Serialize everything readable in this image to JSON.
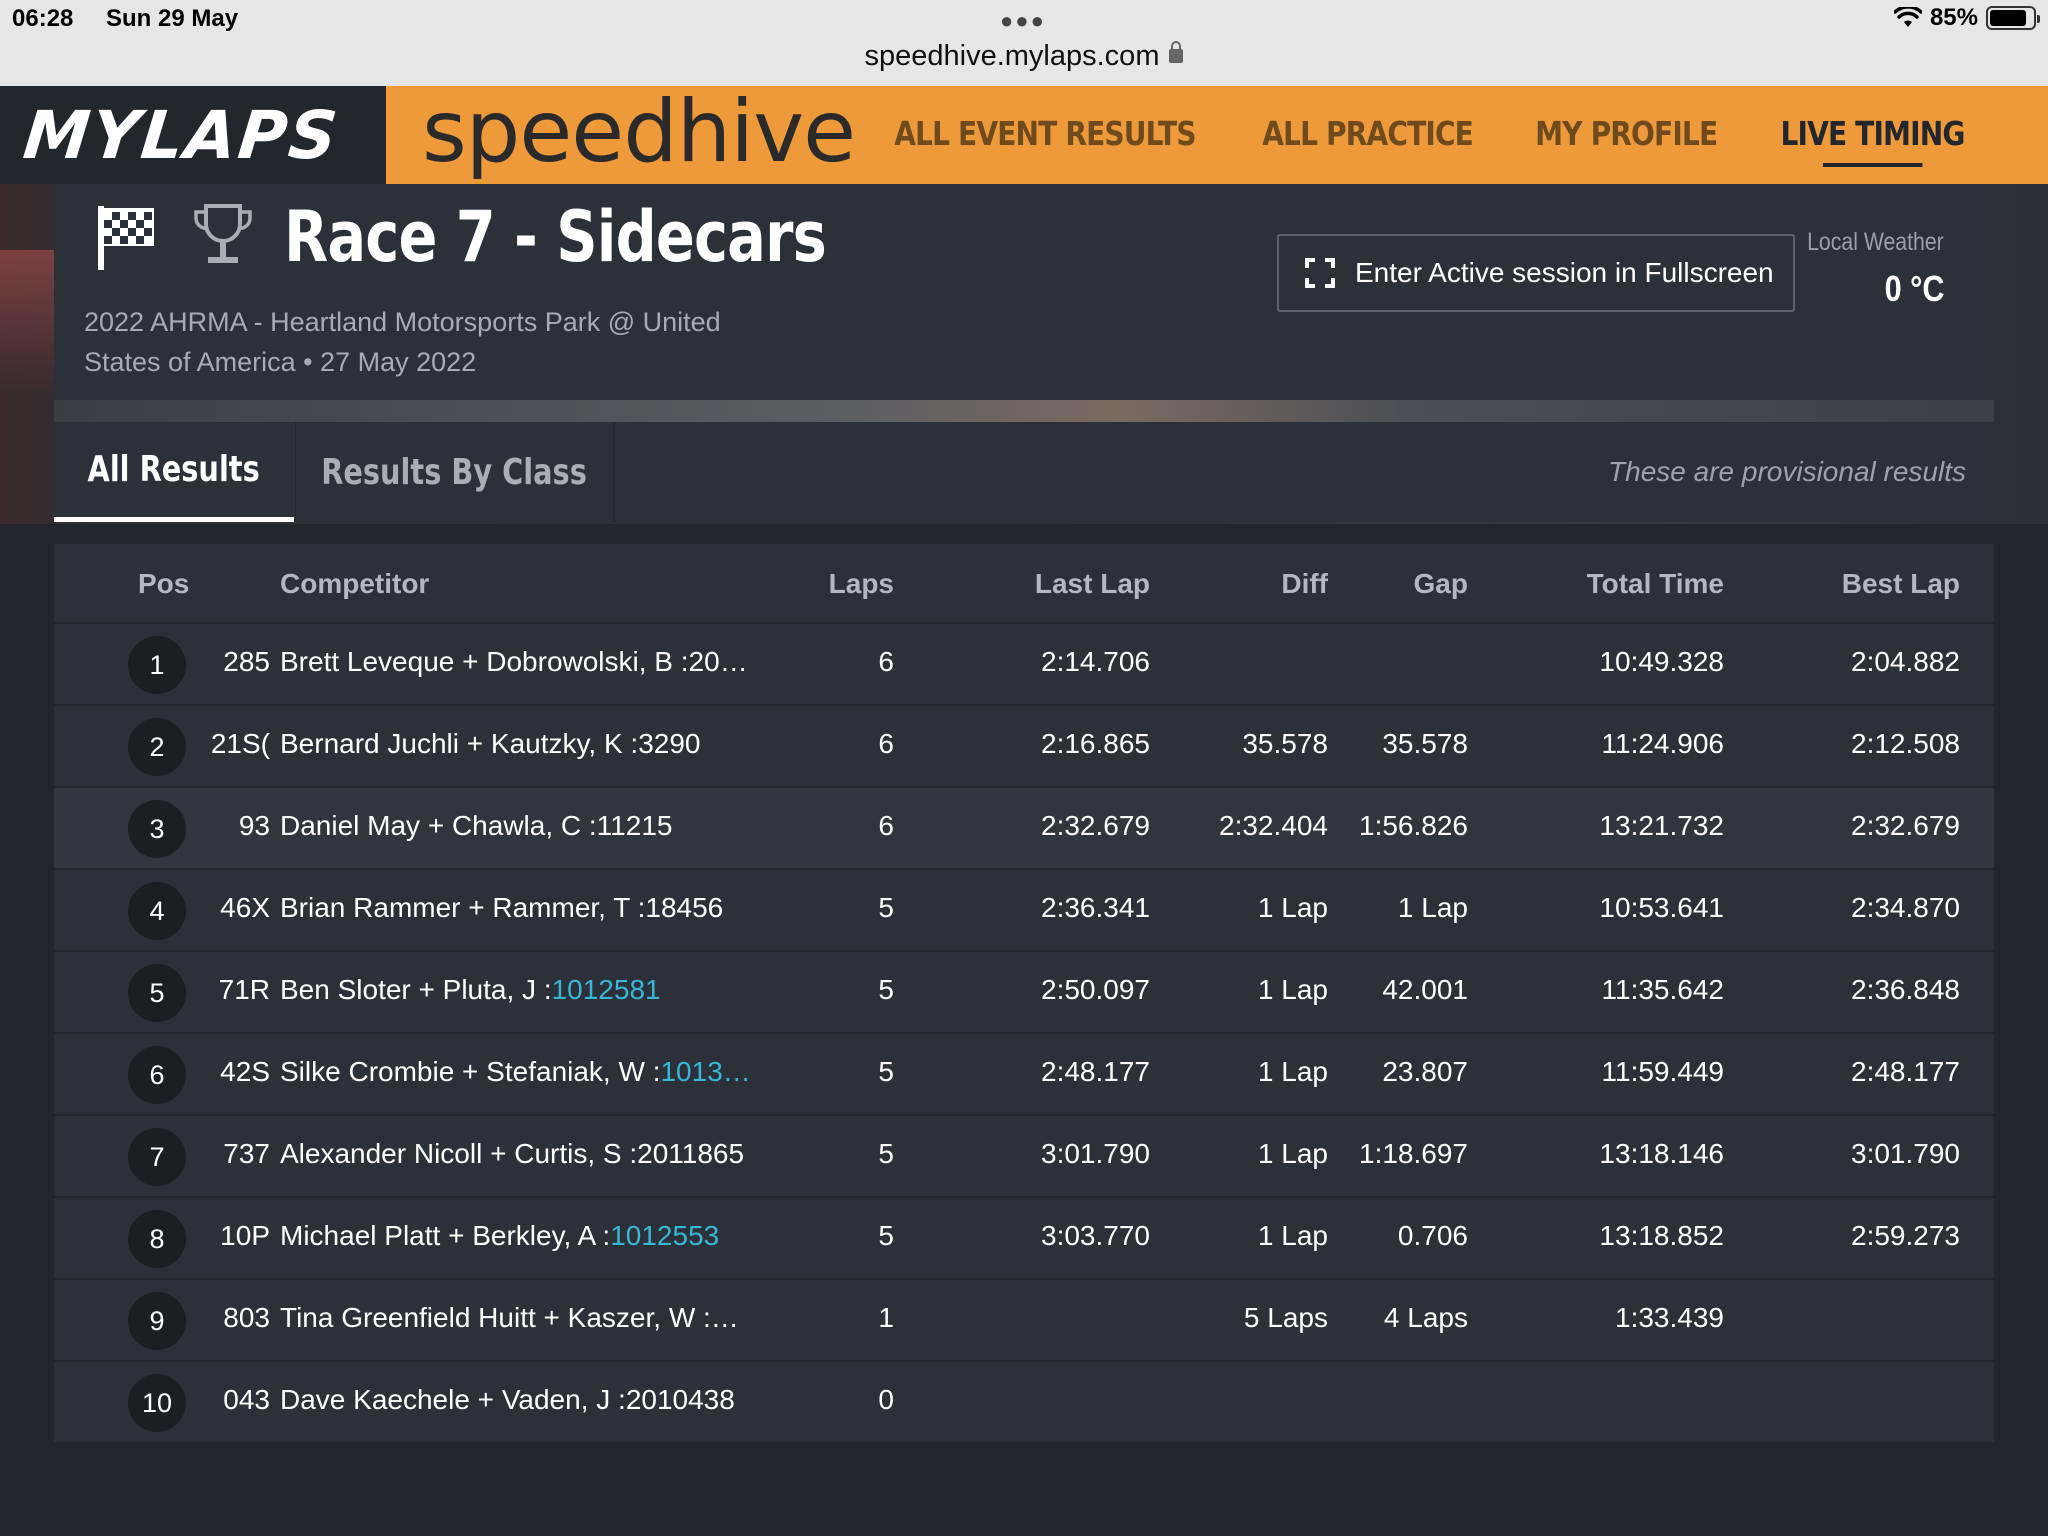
{
  "status_bar": {
    "time": "06:28",
    "date": "Sun 29 May",
    "url": "speedhive.mylaps.com",
    "battery": "85%",
    "battery_level": 0.85
  },
  "header": {
    "brand": "MYLAPS",
    "product": "speedhive",
    "nav": [
      "ALL EVENT RESULTS",
      "ALL PRACTICE",
      "MY PROFILE",
      "LIVE TIMING"
    ],
    "active_nav": "LIVE TIMING",
    "accent_color": "#ee9a3b"
  },
  "event": {
    "title": "Race 7 - Sidecars",
    "subtitle_line1": "2022 AHRMA - Heartland Motorsports Park @ United",
    "subtitle_line2": "States of America • 27 May 2022",
    "fullscreen_label": "Enter Active session in Fullscreen",
    "weather_label": "Local Weather",
    "weather_temp": "0 °C"
  },
  "tabs": {
    "all_results": "All Results",
    "results_by_class": "Results By Class",
    "active": "All Results",
    "provisional_note": "These are provisional results"
  },
  "table": {
    "columns": [
      "Pos",
      "Competitor",
      "Laps",
      "Last Lap",
      "Diff",
      "Gap",
      "Total Time",
      "Best Lap"
    ],
    "rows": [
      {
        "pos": "1",
        "num": "285",
        "name": "Brett Leveque + Dobrowolski, B :20…",
        "link": "",
        "laps": "6",
        "last": "2:14.706",
        "diff": "",
        "gap": "",
        "total": "10:49.328",
        "best": "2:04.882"
      },
      {
        "pos": "2",
        "num": "21S(",
        "name": "Bernard Juchli + Kautzky, K :3290",
        "link": "",
        "laps": "6",
        "last": "2:16.865",
        "diff": "35.578",
        "gap": "35.578",
        "total": "11:24.906",
        "best": "2:12.508"
      },
      {
        "pos": "3",
        "num": "93",
        "name": "Daniel May + Chawla, C :11215",
        "link": "",
        "laps": "6",
        "last": "2:32.679",
        "diff": "2:32.404",
        "gap": "1:56.826",
        "total": "13:21.732",
        "best": "2:32.679"
      },
      {
        "pos": "4",
        "num": "46X",
        "name": "Brian Rammer + Rammer, T :18456",
        "link": "",
        "laps": "5",
        "last": "2:36.341",
        "diff": "1 Lap",
        "gap": "1 Lap",
        "total": "10:53.641",
        "best": "2:34.870"
      },
      {
        "pos": "5",
        "num": "71R",
        "name": "Ben Sloter + Pluta, J :",
        "link": "1012581",
        "laps": "5",
        "last": "2:50.097",
        "diff": "1 Lap",
        "gap": "42.001",
        "total": "11:35.642",
        "best": "2:36.848"
      },
      {
        "pos": "6",
        "num": "42S",
        "name": "Silke Crombie + Stefaniak, W :",
        "link": "1013…",
        "laps": "5",
        "last": "2:48.177",
        "diff": "1 Lap",
        "gap": "23.807",
        "total": "11:59.449",
        "best": "2:48.177"
      },
      {
        "pos": "7",
        "num": "737",
        "name": "Alexander Nicoll + Curtis, S :2011865",
        "link": "",
        "laps": "5",
        "last": "3:01.790",
        "diff": "1 Lap",
        "gap": "1:18.697",
        "total": "13:18.146",
        "best": "3:01.790"
      },
      {
        "pos": "8",
        "num": "10P",
        "name": "Michael Platt + Berkley, A :",
        "link": "1012553",
        "laps": "5",
        "last": "3:03.770",
        "diff": "1 Lap",
        "gap": "0.706",
        "total": "13:18.852",
        "best": "2:59.273"
      },
      {
        "pos": "9",
        "num": "803",
        "name": "Tina Greenfield Huitt + Kaszer, W :…",
        "link": "",
        "laps": "1",
        "last": "",
        "diff": "5 Laps",
        "gap": "4 Laps",
        "total": "1:33.439",
        "best": ""
      },
      {
        "pos": "10",
        "num": "043",
        "name": "Dave Kaechele + Vaden, J :2010438",
        "link": "",
        "laps": "0",
        "last": "",
        "diff": "",
        "gap": "",
        "total": "",
        "best": ""
      }
    ]
  }
}
